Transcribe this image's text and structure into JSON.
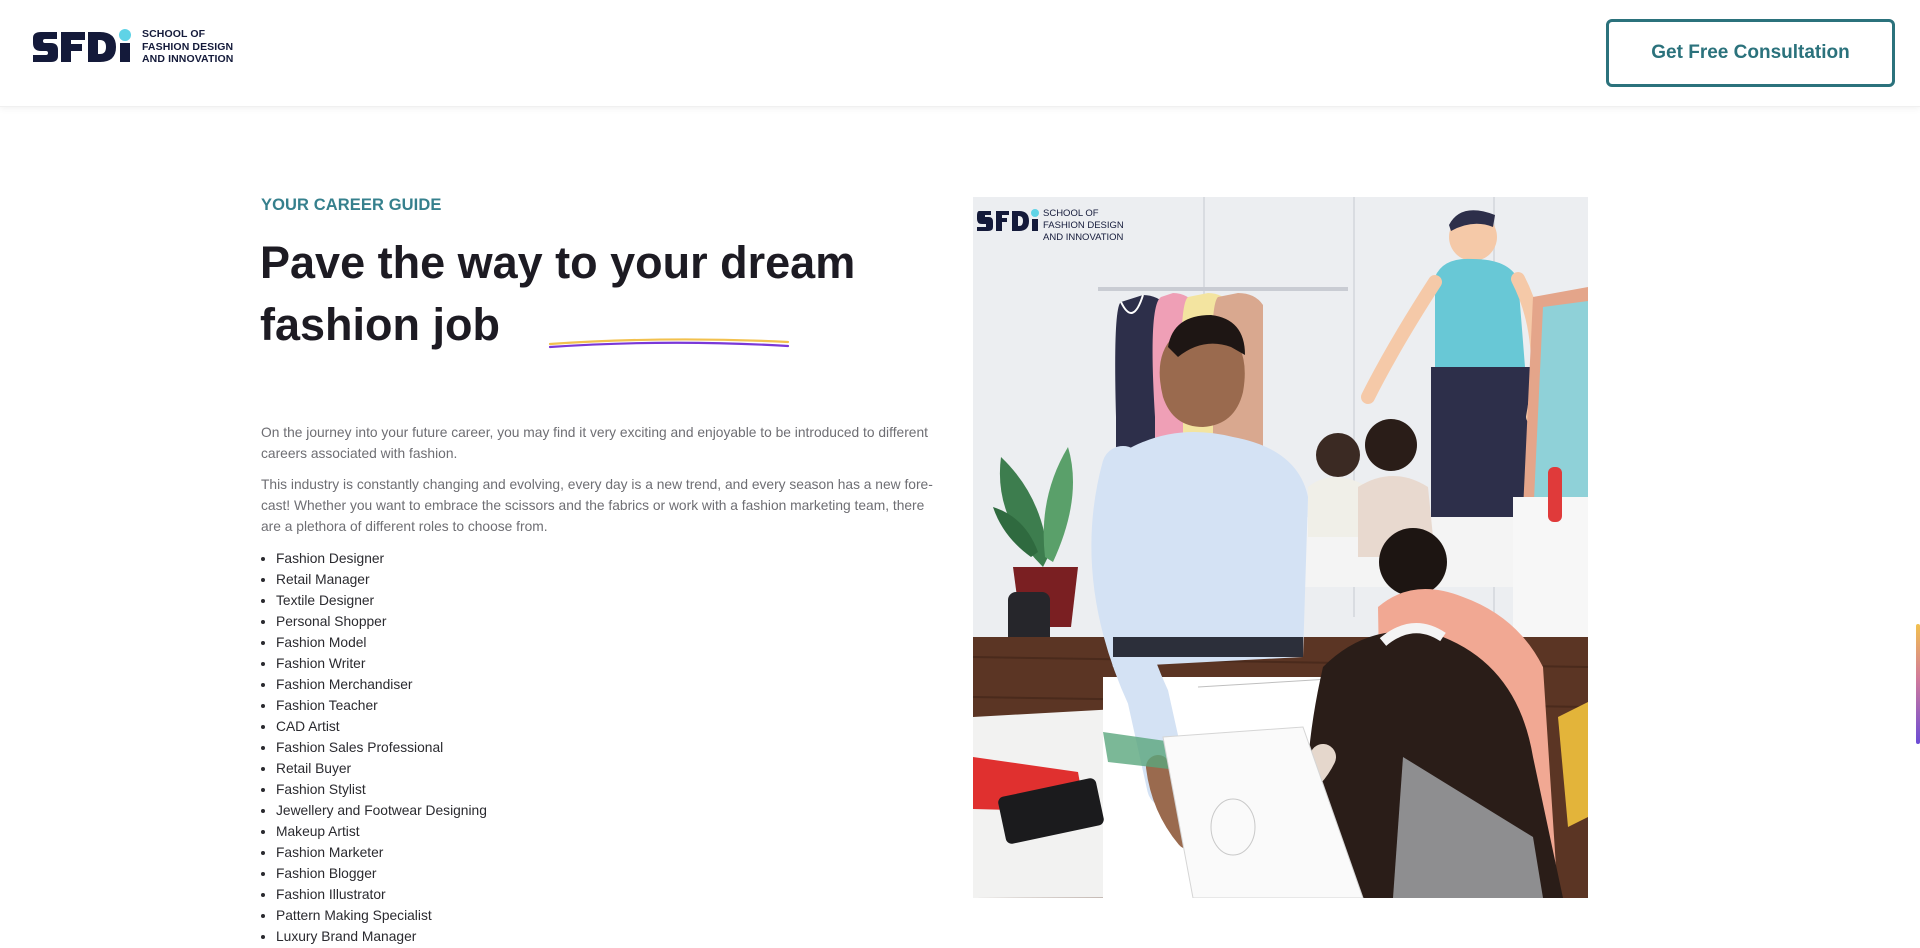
{
  "header": {
    "logo": {
      "lines": [
        "SCHOOL OF",
        "FASHION DESIGN",
        "AND INNOVATION"
      ],
      "mark_icon": "sfdi-logo-mark",
      "brand_color": "#141a3a",
      "dot_color": "#5fd3e6"
    },
    "cta_label": "Get Free Consultation",
    "cta_color": "#2b727c"
  },
  "hero": {
    "eyebrow": "YOUR CAREER GUIDE",
    "title_line1": "Pave the way to your dream",
    "title_line2": "fashion job",
    "underline_colors": [
      "#f2c14e",
      "#7a38d8"
    ],
    "paragraphs": [
      "On the journey into your future career, you may find it very exciting and enjoyable to be introduced to different careers associated with fashion.",
      "This industry is constantly changing and evolving, every day is a new trend, and every season has a new fore-cast! Whether you want to embrace the scissors and the fabrics or work with a fashion marketing team, there are a plethora of different roles to choose from."
    ],
    "roles": [
      "Fashion Designer",
      "Retail Manager",
      "Textile Designer",
      "Personal Shopper",
      "Fashion Model",
      "Fashion Writer",
      "Fashion Merchandiser",
      "Fashion Teacher",
      "CAD Artist",
      "Fashion Sales Professional",
      "Retail Buyer",
      "Fashion Stylist",
      "Jewellery and Footwear Designing",
      "Makeup Artist",
      "Fashion Marketer",
      "Fashion Blogger",
      "Fashion Illustrator",
      "Pattern Making Specialist",
      "Luxury Brand Manager"
    ]
  },
  "photo": {
    "watermark_lines": [
      "SCHOOL OF",
      "FASHION DESIGN",
      "AND INNOVATION"
    ]
  },
  "scroll_indicator_colors": [
    "#f2c14e",
    "#6b4cd6"
  ]
}
